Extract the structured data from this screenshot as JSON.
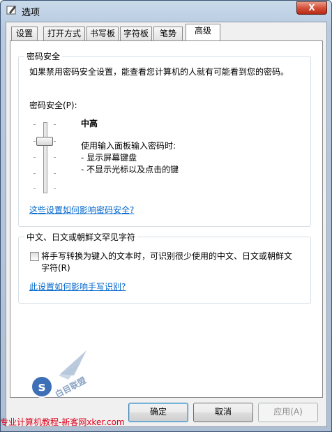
{
  "window": {
    "title": "选项",
    "close_label": "X"
  },
  "tabs": [
    {
      "label": "设置"
    },
    {
      "label": "打开方式"
    },
    {
      "label": "书写板"
    },
    {
      "label": "字符板"
    },
    {
      "label": "笔势"
    },
    {
      "label": "高级",
      "active": true
    }
  ],
  "password_group": {
    "title": "密码安全",
    "description": "如果禁用密码安全设置，能查看您计算机的人就有可能看到您的密码。",
    "slider_label": "密码安全(P):",
    "level_label": "中高",
    "slider_level_fraction": 0.2,
    "detail_heading": "使用输入面板输入密码时:",
    "detail_items": [
      "- 显示屏幕键盘",
      "- 不显示光标以及点击的键"
    ],
    "help_link": "这些设置如何影响密码安全?"
  },
  "cjk_group": {
    "title": "中文、日文或朝鲜文罕见字符",
    "checkbox_checked": false,
    "checkbox_line1": "将手写转换为键入的文本时，可识别很少使用的中文、日文或朝鲜文",
    "checkbox_line2": "字符(R)",
    "help_link": "此设置如何影响手写识别?"
  },
  "buttons": {
    "ok": "确定",
    "cancel": "取消",
    "apply": "应用(A)"
  },
  "watermark": {
    "text": "专业计算机教程-新客网xker.com",
    "logo_text": "s",
    "logo_caption": "白目联盟"
  },
  "colors": {
    "link": "#0066cc",
    "watermark": "#e0001b",
    "close_button": "#c8432b"
  }
}
